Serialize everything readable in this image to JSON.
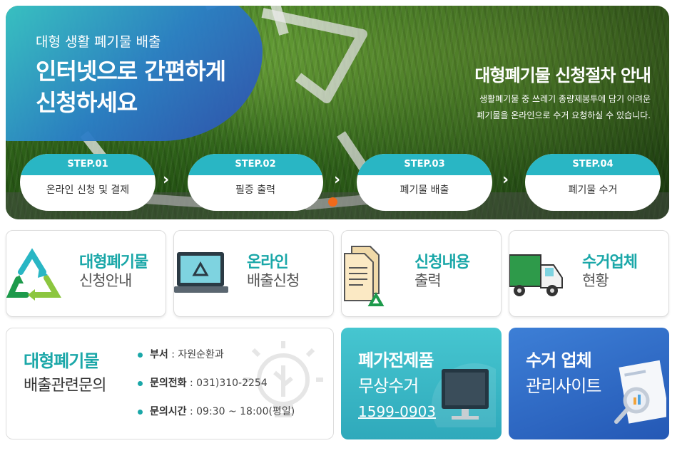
{
  "hero": {
    "subtitle": "대형 생활 폐기물 배출",
    "title_line1": "인터넷으로 간편하게",
    "title_line2": "신청하세요",
    "right_title": "대형폐기물 신청절차 안내",
    "right_desc_line1": "생활폐기물 중 쓰레기 종량제봉투에 담기 어려운",
    "right_desc_line2": "폐기물을 온라인으로 수거 요청하실 수 있습니다.",
    "steps": [
      {
        "step": "STEP.01",
        "label": "온라인 신청 및 결제"
      },
      {
        "step": "STEP.02",
        "label": "필증 출력"
      },
      {
        "step": "STEP.03",
        "label": "폐기물 배출"
      },
      {
        "step": "STEP.04",
        "label": "폐기물 수거"
      }
    ],
    "arrow": "›"
  },
  "cards": [
    {
      "title": "대형폐기물",
      "sub": "신청안내",
      "icon": "recycle-icon"
    },
    {
      "title": "온라인",
      "sub": "배출신청",
      "icon": "laptop-recycle-icon"
    },
    {
      "title": "신청내용",
      "sub": "출력",
      "icon": "document-icon"
    },
    {
      "title": "수거업체",
      "sub": "현황",
      "icon": "truck-icon"
    }
  ],
  "contact": {
    "title": "대형폐기물",
    "sub": "배출관련문의",
    "dept_label": "부서",
    "dept_value": " : 자원순환과",
    "phone_label": "문의전화",
    "phone_value": " : 031)310-2254",
    "hours_label": "문의시간",
    "hours_value": " : 09:30 ~ 18:00(평일)"
  },
  "tiles": [
    {
      "title": "폐가전제품",
      "sub": "무상수거",
      "phone": "1599-0903"
    },
    {
      "title": "수거 업체",
      "sub": "관리사이트"
    }
  ],
  "colors": {
    "accent": "#1aa7a8",
    "step": "#29b6c4",
    "dot": "#f06a1a"
  }
}
